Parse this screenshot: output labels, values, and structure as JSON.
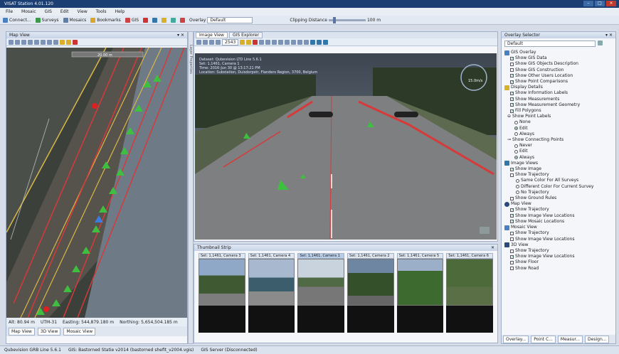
{
  "window": {
    "title": "VISAT Station 4.01.120"
  },
  "menu": [
    "File",
    "Mosaic",
    "GIS",
    "Edit",
    "View",
    "Tools",
    "Help"
  ],
  "toolbar": {
    "connect": "Connect...",
    "surveys": "Surveys",
    "mosaics": "Mosaics",
    "bookmarks": "Bookmarks",
    "gis": "GIS",
    "overlay_label": "Overlay",
    "overlay_value": "Default",
    "clipping_label": "Clipping Distance",
    "clipping_value": "100 m"
  },
  "map": {
    "title": "Map View",
    "scale": "20.00 m",
    "status": {
      "alt": "Alt: 80.94 m",
      "utm": "UTM-31",
      "easting": "Easting: 544,879.180 m",
      "northing": "Northing: 5,654,504.185 m"
    },
    "tabs": [
      "Map View",
      "3D View",
      "Mosaic View"
    ]
  },
  "layer_collapsed": "Layer Properties",
  "image": {
    "tabs": [
      "Image View",
      "GIS Explorer"
    ],
    "frame": "2543",
    "info": [
      "Dataset: Qubevision LTD Line 5.6.1",
      "Set: 1,1461, Camera 1",
      "Time: 2016-Jun 30 @ 13:17:21 PM",
      "Location: Substation, Duisdorpstr, Flanders Region, 3700, Belgium"
    ],
    "compass": "15.0m/s"
  },
  "thumbs": {
    "title": "Thumbnail Strip",
    "captions": [
      "Set: 1,1461, Camera 3",
      "Set: 1,1461, Camera 4",
      "Set: 1,1461, Camera 1",
      "Set: 1,1461, Camera 2",
      "Set: 1,1461, Camera 5",
      "Set: 1,1461, Camera 6"
    ]
  },
  "overlay": {
    "title": "Overlay Selector",
    "dropdown": "Default",
    "items": [
      "GIS Overlay",
      "Show GIS Data",
      "Show GIS Objects Description",
      "Show GIS Construction",
      "Show Other Users Location",
      "Show Point Comparisons",
      "Display Details",
      "Show Information Labels",
      "Show Measurements",
      "Show Measurement Geometry",
      "Fill Polygons",
      "Show Point Labels",
      "None",
      "Edit",
      "Always",
      "Show Connecting Points",
      "Never",
      "Edit",
      "Always",
      "Image Views",
      "Show Image",
      "Show Trajectory",
      "Same Color For All Surveys",
      "Different Color For Current Survey",
      "No Trajectory",
      "Show Ground Rules",
      "Map View",
      "Show Trajectory",
      "Show Image View Locations",
      "Show Mosaic Locations",
      "Mosaic View",
      "Show Trajectory",
      "Show Image View Locations",
      "3D View",
      "Show Trajectory",
      "Show Image View Locations",
      "Show Floor",
      "Show Road"
    ],
    "tabs": [
      "Overlay...",
      "Point C...",
      "Measur...",
      "Design..."
    ]
  },
  "status": [
    "Qubevision GRB Line 5.6.1",
    "GIS: Bastorned Statie v2014 (bastorned shefit_v2004.vgis)",
    "GIS Server (Disconnected)"
  ]
}
